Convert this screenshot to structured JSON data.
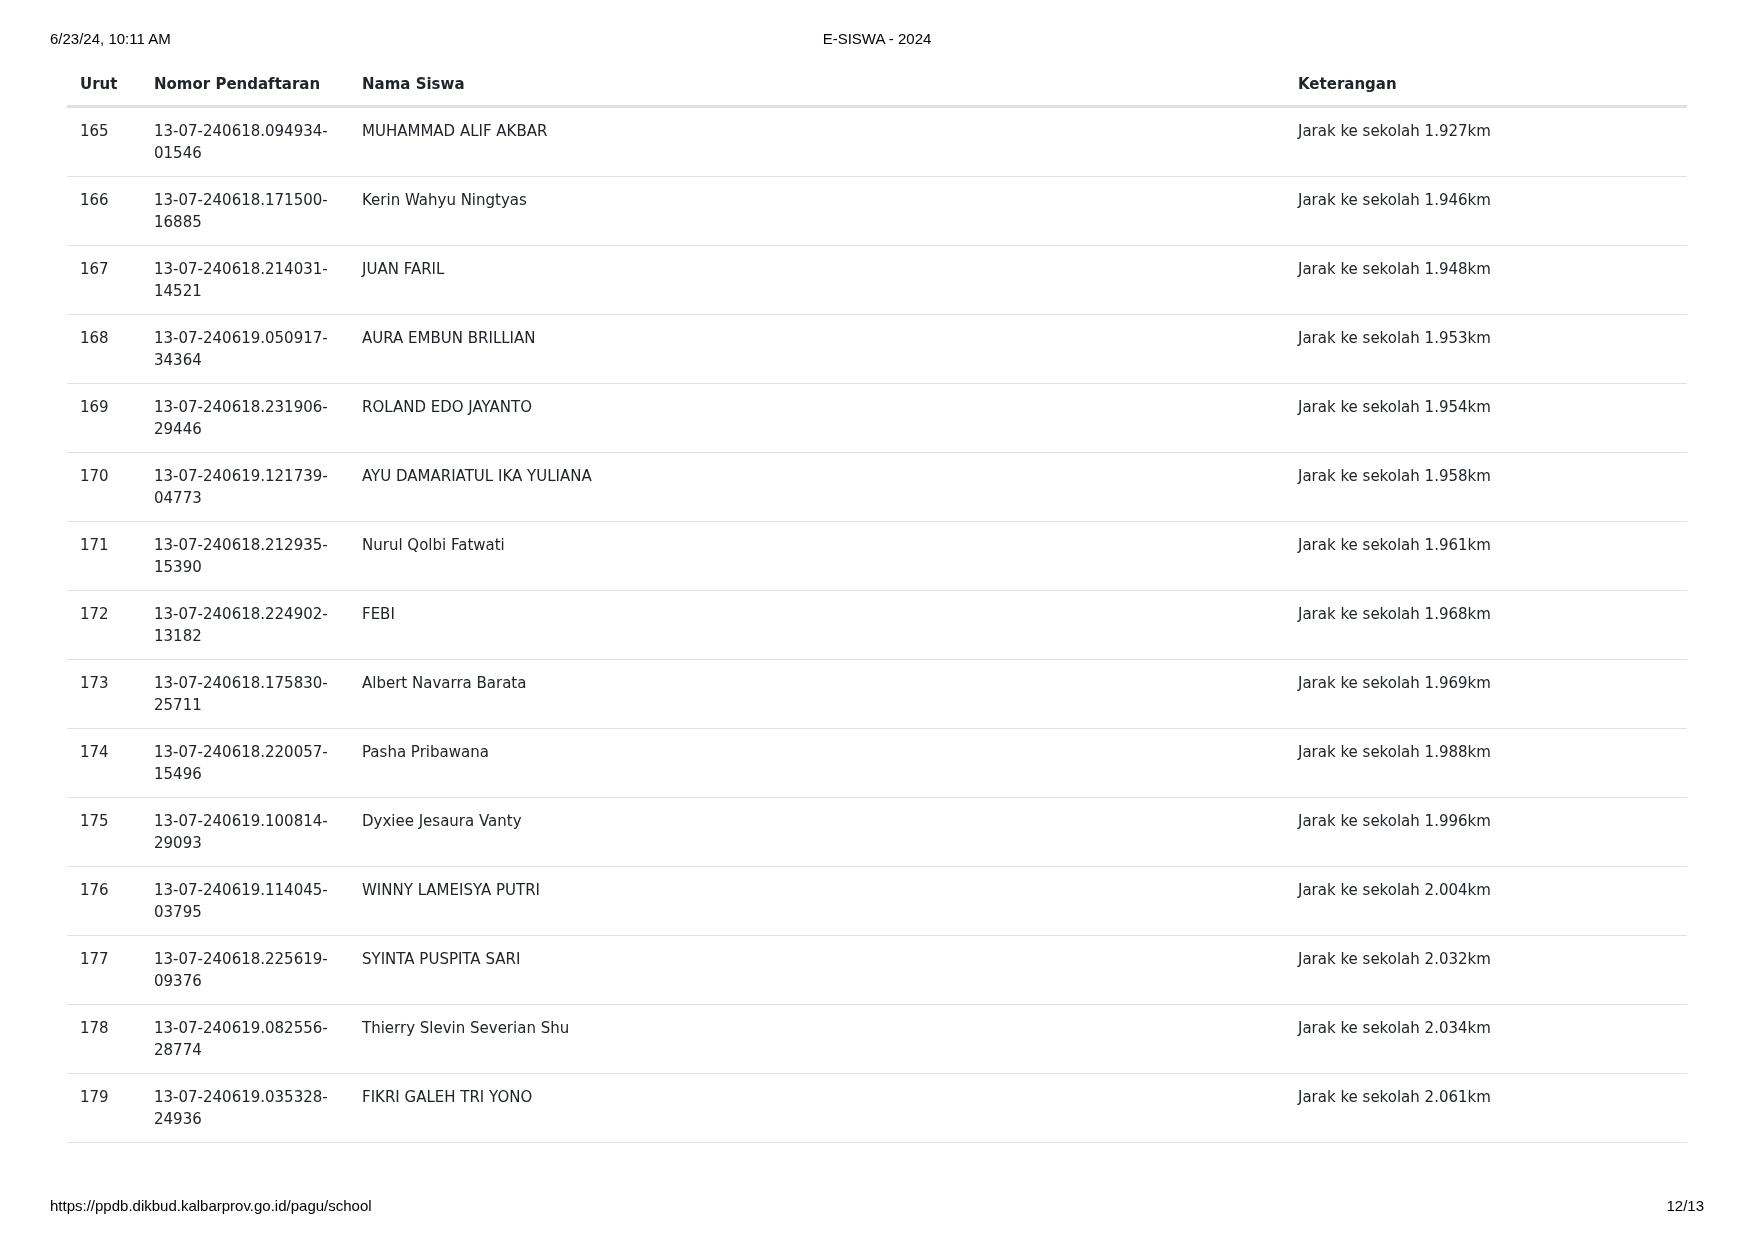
{
  "print_header": {
    "date": "6/23/24, 10:11 AM",
    "title": "E-SISWA - 2024"
  },
  "table": {
    "columns": [
      "Urut",
      "Nomor Pendaftaran",
      "Nama Siswa",
      "Keterangan"
    ],
    "rows": [
      [
        "165",
        "13-07-240618.094934-01546",
        "MUHAMMAD ALIF AKBAR",
        "Jarak ke sekolah 1.927km"
      ],
      [
        "166",
        "13-07-240618.171500-16885",
        "Kerin Wahyu Ningtyas",
        "Jarak ke sekolah 1.946km"
      ],
      [
        "167",
        "13-07-240618.214031-14521",
        "JUAN FARIL",
        "Jarak ke sekolah 1.948km"
      ],
      [
        "168",
        "13-07-240619.050917-34364",
        "AURA EMBUN BRILLIAN",
        "Jarak ke sekolah 1.953km"
      ],
      [
        "169",
        "13-07-240618.231906-29446",
        "ROLAND EDO JAYANTO",
        "Jarak ke sekolah 1.954km"
      ],
      [
        "170",
        "13-07-240619.121739-04773",
        "AYU DAMARIATUL IKA YULIANA",
        "Jarak ke sekolah 1.958km"
      ],
      [
        "171",
        "13-07-240618.212935-15390",
        "Nurul Qolbi Fatwati",
        "Jarak ke sekolah 1.961km"
      ],
      [
        "172",
        "13-07-240618.224902-13182",
        "FEBI",
        "Jarak ke sekolah 1.968km"
      ],
      [
        "173",
        "13-07-240618.175830-25711",
        "Albert Navarra Barata",
        "Jarak ke sekolah 1.969km"
      ],
      [
        "174",
        "13-07-240618.220057-15496",
        "Pasha Pribawana",
        "Jarak ke sekolah 1.988km"
      ],
      [
        "175",
        "13-07-240619.100814-29093",
        "Dyxiee Jesaura Vanty",
        "Jarak ke sekolah 1.996km"
      ],
      [
        "176",
        "13-07-240619.114045-03795",
        "WINNY LAMEISYA PUTRI",
        "Jarak ke sekolah 2.004km"
      ],
      [
        "177",
        "13-07-240618.225619-09376",
        "SYINTA PUSPITA SARI",
        "Jarak ke sekolah 2.032km"
      ],
      [
        "178",
        "13-07-240619.082556-28774",
        "Thierry Slevin Severian Shu",
        "Jarak ke sekolah 2.034km"
      ],
      [
        "179",
        "13-07-240619.035328-24936",
        "FIKRI GALEH TRI YONO",
        "Jarak ke sekolah 2.061km"
      ]
    ]
  },
  "print_footer": {
    "url": "https://ppdb.dikbud.kalbarprov.go.id/pagu/school",
    "page": "12/13"
  }
}
